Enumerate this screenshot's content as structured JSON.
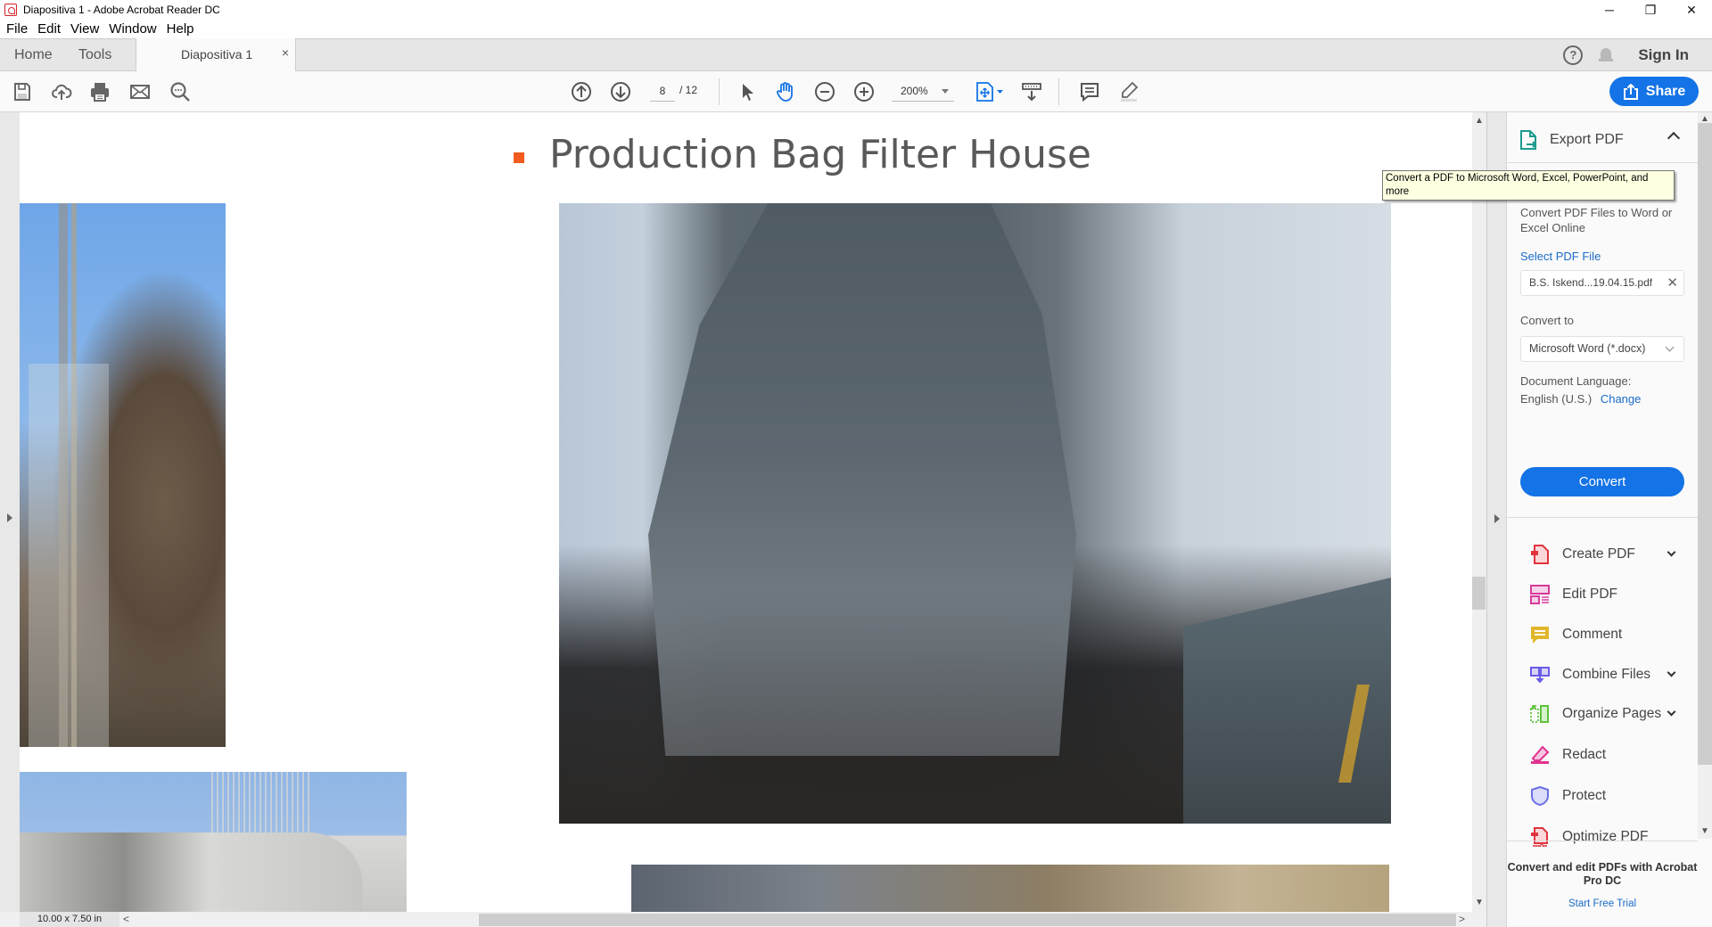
{
  "window": {
    "title": "Diapositiva 1 - Adobe Acrobat Reader DC",
    "minimize": "─",
    "restore": "❐",
    "close": "✕"
  },
  "menu": [
    "File",
    "Edit",
    "View",
    "Window",
    "Help"
  ],
  "tabs": {
    "home": "Home",
    "tools": "Tools",
    "document": "Diapositiva 1",
    "close": "×",
    "sign_in": "Sign In",
    "help": "?"
  },
  "toolbar": {
    "left_icons": [
      "save-icon",
      "upload-cloud-icon",
      "print-icon",
      "email-icon",
      "search-icon"
    ],
    "current_page": "8",
    "total_pages": "/ 12",
    "zoom": "200%",
    "share_label": "Share"
  },
  "document": {
    "slide_title": "Production Bag Filter House",
    "bullet_color": "#f35a1f",
    "page_size": "10.00 x 7.50 in"
  },
  "tooltip": "Convert a PDF to Microsoft Word, Excel, PowerPoint, and more",
  "panel": {
    "export": {
      "title": "Export PDF",
      "description": "Convert PDF Files to Word or Excel Online",
      "select_file_label": "Select PDF File",
      "file_name": "B.S. Iskend...19.04.15.pdf",
      "convert_to_label": "Convert to",
      "convert_to_value": "Microsoft Word (*.docx)",
      "language_label": "Document Language:",
      "language_value": "English (U.S.)",
      "change_link": "Change",
      "convert_button": "Convert"
    },
    "tools": [
      {
        "label": "Create PDF",
        "icon": "create-pdf-icon",
        "color": "#e0333d",
        "expandable": true
      },
      {
        "label": "Edit PDF",
        "icon": "edit-pdf-icon",
        "color": "#d63a9a",
        "expandable": false
      },
      {
        "label": "Comment",
        "icon": "comment-icon",
        "color": "#e0b62b",
        "expandable": false
      },
      {
        "label": "Combine Files",
        "icon": "combine-files-icon",
        "color": "#6a5de6",
        "expandable": true
      },
      {
        "label": "Organize Pages",
        "icon": "organize-pages-icon",
        "color": "#5dc23d",
        "expandable": true
      },
      {
        "label": "Redact",
        "icon": "redact-icon",
        "color": "#e0338f",
        "expandable": false
      },
      {
        "label": "Protect",
        "icon": "protect-icon",
        "color": "#6a6fe6",
        "expandable": false
      },
      {
        "label": "Optimize PDF",
        "icon": "optimize-pdf-icon",
        "color": "#e0333d",
        "expandable": false
      }
    ],
    "promo_title": "Convert and edit PDFs with Acrobat Pro DC",
    "promo_link": "Start Free Trial"
  },
  "colors": {
    "accent": "#1473e6",
    "link": "#1a6bc8",
    "export_icon": "#1b9a8c"
  }
}
